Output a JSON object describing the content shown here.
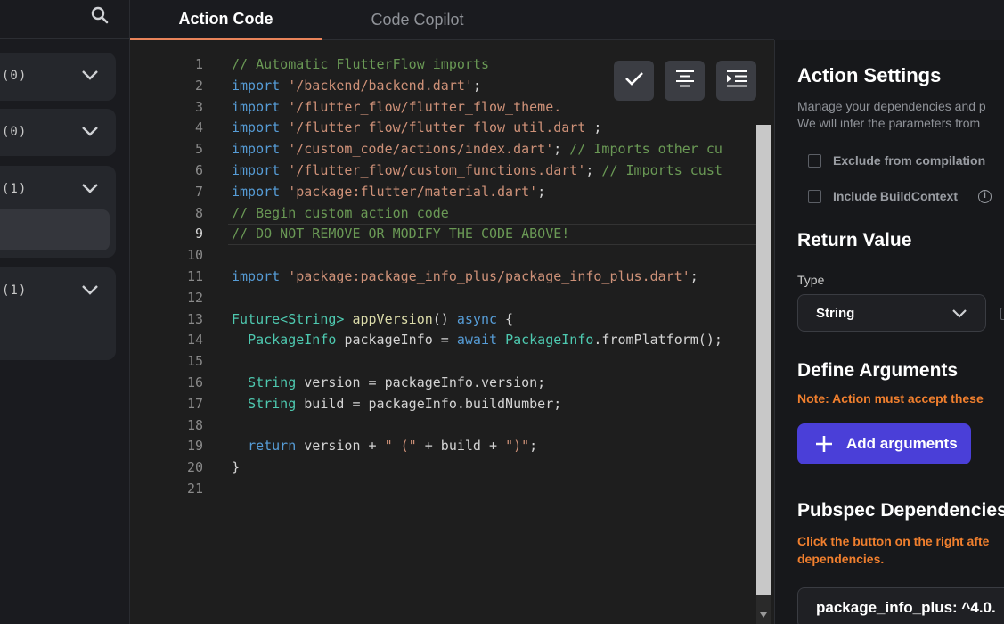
{
  "sidebar": {
    "groups": [
      {
        "count": "(0)"
      },
      {
        "count": "(0)"
      },
      {
        "count": "(1)"
      },
      {
        "count": "(1)"
      }
    ]
  },
  "tabs": [
    {
      "label": "Action Code",
      "active": true
    },
    {
      "label": "Code Copilot",
      "active": false
    }
  ],
  "editor": {
    "current_line": 9,
    "line_numbers": [
      "1",
      "2",
      "3",
      "4",
      "5",
      "6",
      "7",
      "8",
      "9",
      "10",
      "11",
      "12",
      "13",
      "14",
      "15",
      "16",
      "17",
      "18",
      "19",
      "20",
      "21"
    ],
    "code": {
      "l1": "// Automatic FlutterFlow imports",
      "l2_kw": "import",
      "l2_str": "'/backend/backend.dart'",
      "l3_kw": "import",
      "l3_str": "'/flutter_flow/flutter_flow_theme.",
      "l4_kw": "import",
      "l4_str": "'/flutter_flow/flutter_flow_util.dart",
      "l5_kw": "import",
      "l5_str": "'/custom_code/actions/index.dart'",
      "l5_cmt": "// Imports other cu",
      "l6_kw": "import",
      "l6_str": "'/flutter_flow/custom_functions.dart'",
      "l6_cmt": "// Imports cust",
      "l7_kw": "import",
      "l7_str": "'package:flutter/material.dart'",
      "l8": "// Begin custom action code",
      "l9": "// DO NOT REMOVE OR MODIFY THE CODE ABOVE!",
      "l11_kw": "import",
      "l11_str": "'package:package_info_plus/package_info_plus.dart'",
      "l13_type": "Future<String>",
      "l13_fn": "appVersion",
      "l13_kw": "async",
      "l14_type": "PackageInfo",
      "l14_var": "packageInfo",
      "l14_kw": "await",
      "l14_type2": "PackageInfo",
      "l14_call": ".fromPlatform();",
      "l16_type": "String",
      "l16_rest": "version = packageInfo.version;",
      "l17_type": "String",
      "l17_rest": "build = packageInfo.buildNumber;",
      "l19_kw": "return",
      "l19_a": "version +",
      "l19_s1": "\" (\"",
      "l19_b": "+ build +",
      "l19_s2": "\")\"",
      "l20": "}"
    }
  },
  "settings": {
    "title": "Action Settings",
    "desc_line1": "Manage your dependencies and p",
    "desc_line2": "We will infer the parameters from",
    "exclude_label": "Exclude from compilation",
    "include_label": "Include BuildContext",
    "info_glyph": "i",
    "return_title": "Return Value",
    "type_label": "Type",
    "type_value": "String",
    "args_title": "Define Arguments",
    "args_note": "Note: Action must accept these",
    "add_args_label": "Add arguments",
    "pubspec_title": "Pubspec Dependencies",
    "pubspec_note_line1": "Click the button on the right afte",
    "pubspec_note_line2": "dependencies.",
    "dependency_value": "package_info_plus: ^4.0."
  },
  "colors": {
    "accent_tab": "#e8835a",
    "button_primary": "#4a3fd8",
    "note_orange": "#f07f2e"
  }
}
